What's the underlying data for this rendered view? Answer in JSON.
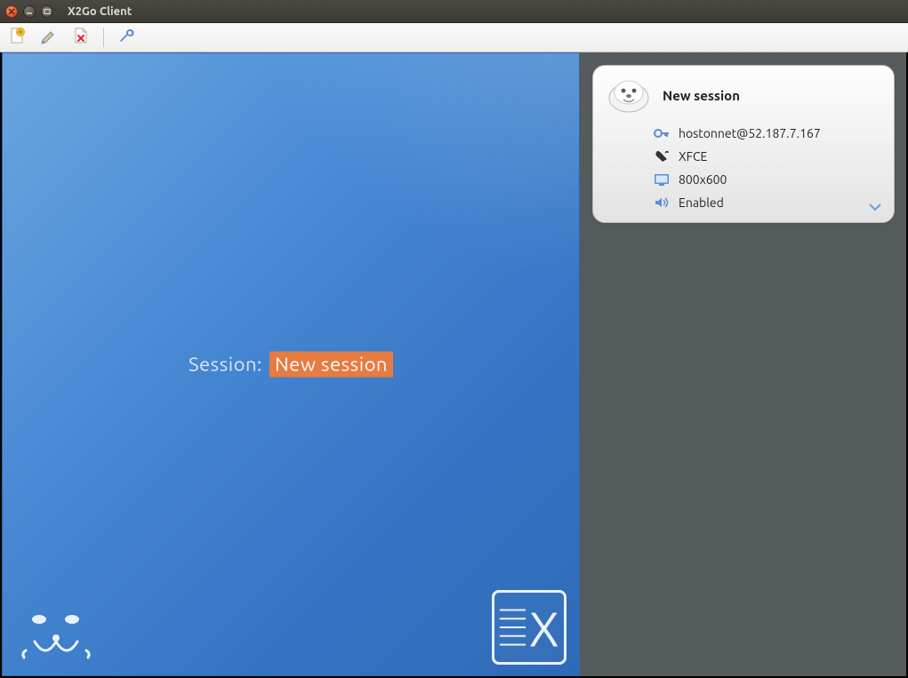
{
  "window": {
    "title": "X2Go Client"
  },
  "toolbar": {
    "new_session": "new-session",
    "edit_session": "edit-session",
    "delete_session": "delete-session",
    "settings": "settings"
  },
  "left_panel": {
    "label": "Session:",
    "session_value": "New session"
  },
  "session_card": {
    "title": "New session",
    "connection": "hostonnet@52.187.7.167",
    "desktop": "XFCE",
    "resolution": "800x600",
    "sound": "Enabled"
  }
}
